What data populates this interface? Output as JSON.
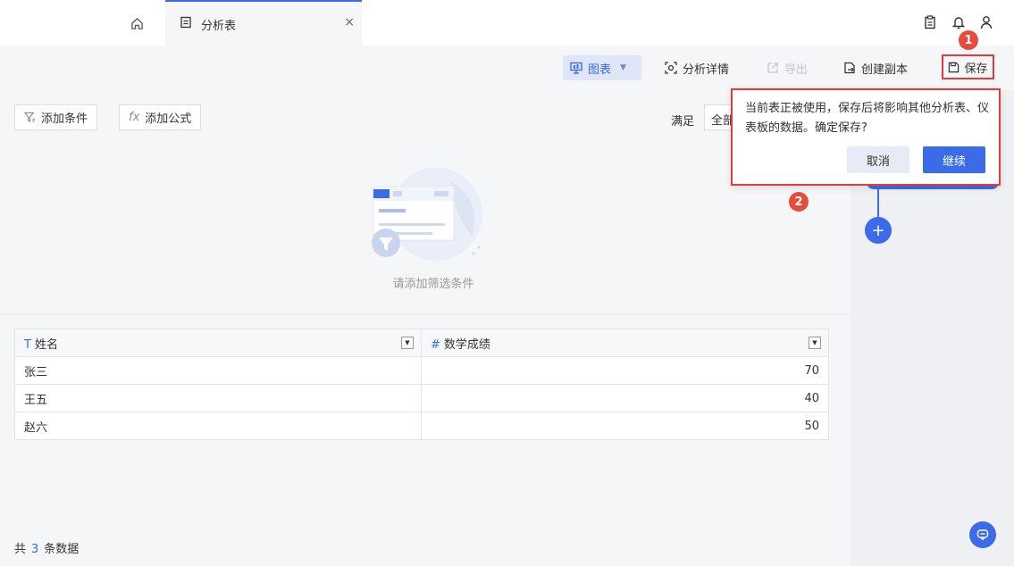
{
  "tabs": {
    "active_label": "分析表",
    "close": "×"
  },
  "toolbar": {
    "chart": "图表",
    "chart_arrow": "▼",
    "details": "分析详情",
    "export": "导出",
    "duplicate": "创建副本",
    "save": "保存"
  },
  "filters": {
    "add_condition": "添加条件",
    "add_formula": "添加公式",
    "formula_icon": "fx",
    "satisfy_label": "满足",
    "satisfy_value": "全部",
    "empty_hint": "请添加筛选条件"
  },
  "table": {
    "columns": [
      {
        "icon": "T",
        "name": "姓名"
      },
      {
        "icon": "#",
        "name": "数学成绩"
      }
    ],
    "rows": [
      {
        "name": "张三",
        "score": "70"
      },
      {
        "name": "王五",
        "score": "40"
      },
      {
        "name": "赵六",
        "score": "50"
      }
    ]
  },
  "footer": {
    "prefix": "共",
    "count": "3",
    "suffix": "条数据"
  },
  "popover": {
    "message": "当前表正被使用，保存后将影响其他分析表、仪表板的数据。确定保存?",
    "cancel": "取消",
    "confirm": "继续"
  },
  "annotations": {
    "badge1": "1",
    "badge2": "2"
  },
  "flow": {
    "plus": "+"
  },
  "colors": {
    "accent": "#3b6be6",
    "highlight": "#e53b3b",
    "badge": "#e84a3c"
  },
  "icons": [
    "home-icon",
    "document-icon",
    "clipboard-icon",
    "bell-icon",
    "user-icon",
    "presentation-icon",
    "scan-icon",
    "export-icon",
    "copy-icon",
    "save-icon",
    "filter-icon",
    "formula-icon",
    "funnel-icon",
    "chat-icon"
  ]
}
